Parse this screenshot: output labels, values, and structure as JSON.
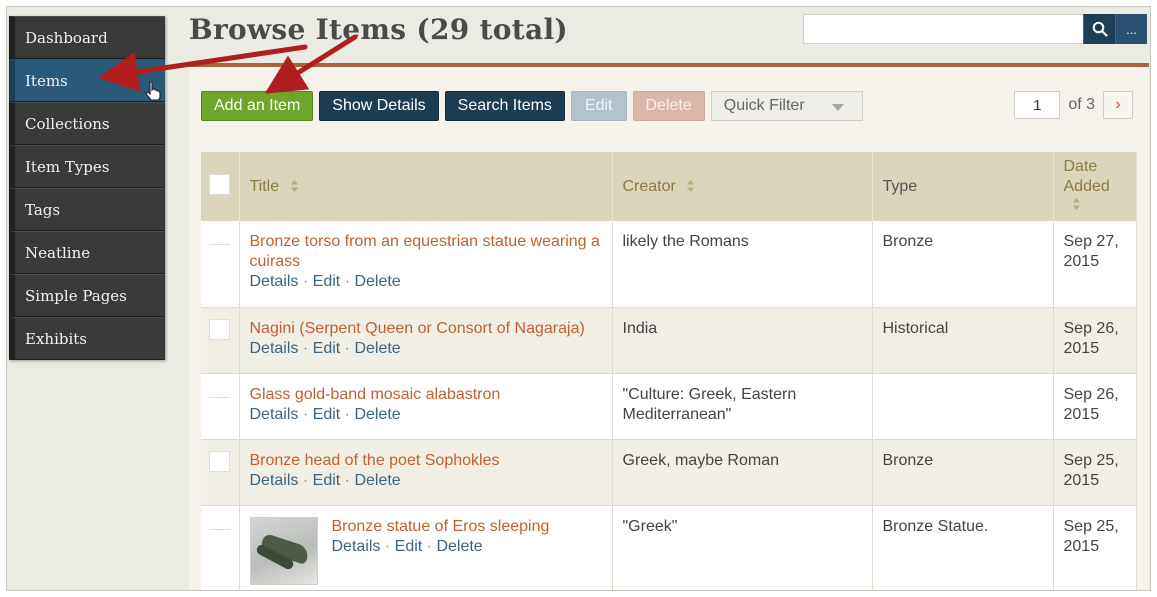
{
  "sidebar": {
    "items": [
      {
        "label": "Dashboard"
      },
      {
        "label": "Items"
      },
      {
        "label": "Collections"
      },
      {
        "label": "Item Types"
      },
      {
        "label": "Tags"
      },
      {
        "label": "Neatline"
      },
      {
        "label": "Simple Pages"
      },
      {
        "label": "Exhibits"
      }
    ],
    "active": "Items"
  },
  "header": {
    "title": "Browse Items (29 total)",
    "search": {
      "value": "",
      "more_label": "..."
    }
  },
  "toolbar": {
    "add_label": "Add an Item",
    "details_label": "Show Details",
    "search_label": "Search Items",
    "edit_label": "Edit",
    "delete_label": "Delete",
    "quick_filter_label": "Quick Filter"
  },
  "pagination": {
    "current": "1",
    "of_label": "of 3",
    "next": "›"
  },
  "table": {
    "headers": {
      "title": "Title",
      "creator": "Creator",
      "type": "Type",
      "date_line1": "Date",
      "date_line2": "Added"
    },
    "action_labels": {
      "details": "Details",
      "edit": "Edit",
      "delete": "Delete",
      "sep": "·"
    },
    "rows": [
      {
        "title_line1": "Bronze torso from an equestrian statue wearing a",
        "title_line2": "cuirass",
        "creator_line1": "likely the Romans",
        "creator_line2": "",
        "type": "Bronze",
        "date_line1": "Sep 27,",
        "date_line2": "2015"
      },
      {
        "title_line1": "Nagini (Serpent Queen or Consort of Nagaraja)",
        "title_line2": "",
        "creator_line1": "India",
        "creator_line2": "",
        "type": "Historical",
        "date_line1": "Sep 26,",
        "date_line2": "2015"
      },
      {
        "title_line1": "Glass gold-band mosaic alabastron",
        "title_line2": "",
        "creator_line1": "\"Culture: Greek, Eastern",
        "creator_line2": "Mediterranean\"",
        "type": "",
        "date_line1": "Sep 26,",
        "date_line2": "2015"
      },
      {
        "title_line1": "Bronze head of the poet Sophokles",
        "title_line2": "",
        "creator_line1": "Greek, maybe Roman",
        "creator_line2": "",
        "type": "Bronze",
        "date_line1": "Sep 25,",
        "date_line2": "2015"
      },
      {
        "title_line1": "Bronze statue of Eros sleeping",
        "title_line2": "",
        "creator_line1": "\"Greek\"",
        "creator_line2": "",
        "type": "Bronze Statue.",
        "date_line1": "Sep 25,",
        "date_line2": "2015"
      }
    ]
  },
  "colors": {
    "accent_green": "#6ea52a",
    "navy": "#1f3d52",
    "link_orange": "#c2602e",
    "arrow_red": "#b01e1e"
  }
}
